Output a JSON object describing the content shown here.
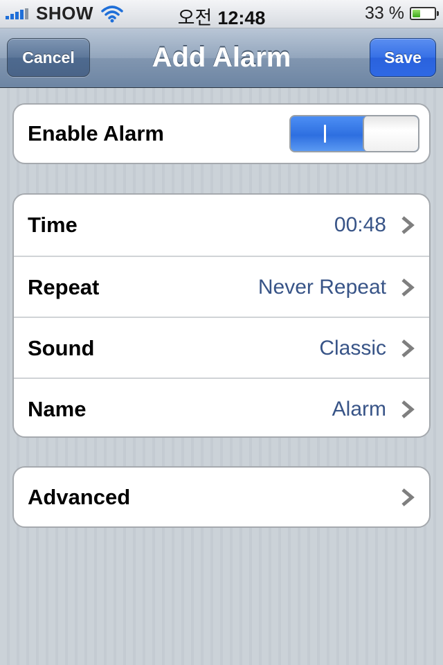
{
  "status_bar": {
    "carrier": "SHOW",
    "time_period": "오전",
    "time": "12:48",
    "battery_percent": "33 %",
    "battery_level": 0.33,
    "signal_bars": 4,
    "icons": [
      "signal-icon",
      "wifi-icon",
      "battery-icon"
    ]
  },
  "nav": {
    "title": "Add Alarm",
    "cancel_label": "Cancel",
    "save_label": "Save"
  },
  "enable": {
    "label": "Enable Alarm",
    "toggle_on_mark": "I",
    "state": "on"
  },
  "rows": [
    {
      "label": "Time",
      "value": "00:48"
    },
    {
      "label": "Repeat",
      "value": "Never Repeat"
    },
    {
      "label": "Sound",
      "value": "Classic"
    },
    {
      "label": "Name",
      "value": "Alarm"
    }
  ],
  "advanced": {
    "label": "Advanced"
  },
  "colors": {
    "accent": "#2f6ce0",
    "value_text": "#385487",
    "background": "#c5ccd4"
  }
}
